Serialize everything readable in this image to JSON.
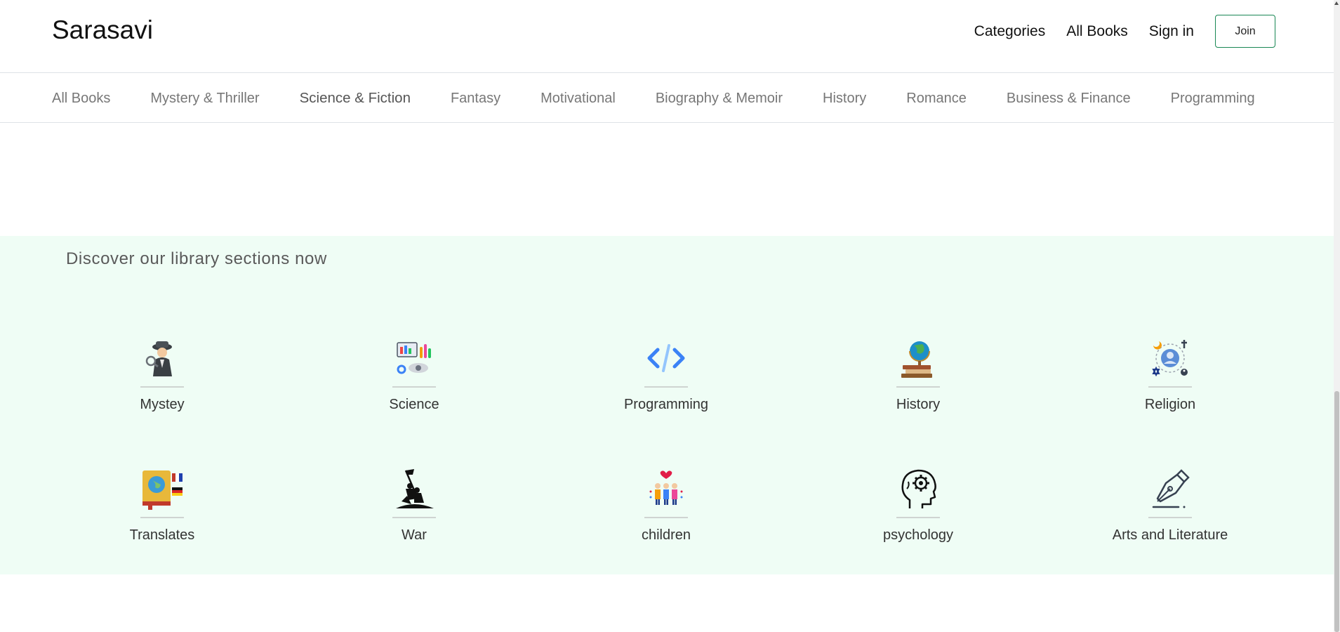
{
  "header": {
    "brand": "Sarasavi",
    "nav": [
      "Categories",
      "All Books",
      "Sign in"
    ],
    "join_label": "Join"
  },
  "categories": {
    "items": [
      "All Books",
      "Mystery & Thriller",
      "Science & Fiction",
      "Fantasy",
      "Motivational",
      "Biography & Memoir",
      "History",
      "Romance",
      "Business & Finance",
      "Programming"
    ],
    "active": "Science & Fiction"
  },
  "library": {
    "heading": "Discover our library sections now",
    "sections": [
      {
        "label": "Mystey",
        "icon": "detective-icon"
      },
      {
        "label": "Science",
        "icon": "science-lab-icon"
      },
      {
        "label": "Programming",
        "icon": "code-icon"
      },
      {
        "label": "History",
        "icon": "globe-books-icon"
      },
      {
        "label": "Religion",
        "icon": "religion-symbols-icon"
      },
      {
        "label": "Translates",
        "icon": "translate-book-icon"
      },
      {
        "label": "War",
        "icon": "soldiers-flag-icon"
      },
      {
        "label": "children",
        "icon": "children-icon"
      },
      {
        "label": "psychology",
        "icon": "head-gear-icon"
      },
      {
        "label": "Arts and Literature",
        "icon": "fountain-pen-icon"
      }
    ]
  },
  "colors": {
    "accent": "#198754",
    "section_bg": "#effdf5",
    "code_blue": "#3b82f6"
  }
}
